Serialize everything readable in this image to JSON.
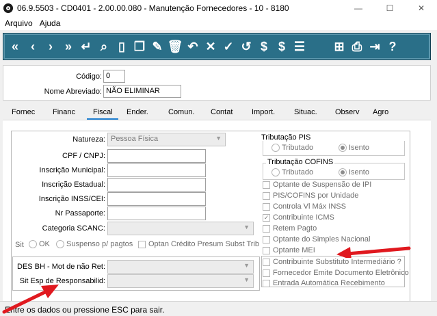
{
  "window": {
    "title": "06.9.5503 - CD0401 - 2.00.00.080 - Manutenção Fornecedores - 10 - 8180",
    "minimize": "—",
    "maximize": "☐",
    "close": "✕"
  },
  "menu": {
    "items": [
      "Arquivo",
      "Ajuda"
    ]
  },
  "toolbar": {
    "buttons": [
      {
        "name": "first-record-icon",
        "glyph": "«"
      },
      {
        "name": "previous-record-icon",
        "glyph": "‹"
      },
      {
        "name": "next-record-icon",
        "glyph": "›"
      },
      {
        "name": "last-record-icon",
        "glyph": "»"
      },
      {
        "name": "enter-icon",
        "glyph": "↵"
      },
      {
        "name": "search-icon",
        "glyph": "⌕"
      },
      {
        "name": "new-document-icon",
        "glyph": "▯"
      },
      {
        "name": "copy-icon",
        "glyph": "❐"
      },
      {
        "name": "edit-icon",
        "glyph": "✎"
      },
      {
        "name": "trash-icon",
        "glyph": "🗑"
      },
      {
        "name": "undo-icon",
        "glyph": "↶"
      },
      {
        "name": "cancel-icon",
        "glyph": "✕"
      },
      {
        "name": "confirm-icon",
        "glyph": "✓"
      },
      {
        "name": "history-icon",
        "glyph": "↺"
      },
      {
        "name": "coin-icon",
        "glyph": "$"
      },
      {
        "name": "dollar-icon",
        "glyph": "$"
      },
      {
        "name": "checklist-icon",
        "glyph": "☰"
      },
      {
        "name": "sitemap-icon",
        "glyph": "⊞"
      },
      {
        "name": "print-icon",
        "glyph": "⎙"
      },
      {
        "name": "exit-icon",
        "glyph": "⇥"
      },
      {
        "name": "help-icon",
        "glyph": "?"
      }
    ]
  },
  "header": {
    "codigo_label": "Código:",
    "codigo_value": "0",
    "nome_label": "Nome Abreviado:",
    "nome_value": "NÃO ELIMINAR"
  },
  "tabs": [
    "Fornec",
    "Financ",
    "Fiscal",
    "Ender.",
    "Comun.",
    "Contat",
    "Import.",
    "Situac.",
    "Observ",
    "Agro"
  ],
  "fiscal": {
    "natureza_label": "Natureza:",
    "natureza_value": "Pessoa Física",
    "cpf_label": "CPF / CNPJ:",
    "insc_municipal_label": "Inscrição Municipal:",
    "insc_estadual_label": "Inscrição Estadual:",
    "insc_inss_label": "Inscrição INSS/CEI:",
    "passaporte_label": "Nr Passaporte:",
    "categoria_label": "Categoria SCANC:",
    "sit_label": "Sit",
    "sit_ok": "OK",
    "sit_suspenso": "Suspenso p/ pagtos",
    "optan_credito": "Optan Crédito Presum Subst Trib",
    "des_bh_label": "DES BH - Mot de não Ret:",
    "sit_esp_label": "Sit Esp de Responsabilid:",
    "pis_title": "Tributação PIS",
    "pis_tributado": "Tributado",
    "pis_isento": "Isento",
    "cofins_title": "Tributação COFINS",
    "cofins_tributado": "Tributado",
    "cofins_isento": "Isento",
    "checks": [
      "Optante de Suspensão de IPI",
      "PIS/COFINS por Unidade",
      "Controla Vl Máx INSS",
      "Contribuinte ICMS",
      "Retem Pagto",
      "Optante do Simples Nacional",
      "Optante MEI"
    ],
    "checks2": [
      "Contribuinte Substituto Intermediário ?",
      "Fornecedor Emite Documento Eletrônico",
      "Entrada Automática Recebimento"
    ]
  },
  "status": {
    "message": "Entre os dados ou pressione ESC para sair."
  },
  "colors": {
    "toolbar": "#2a6f88",
    "annotation_arrow": "#e0191f",
    "active_tab": "#1f7fd0"
  }
}
